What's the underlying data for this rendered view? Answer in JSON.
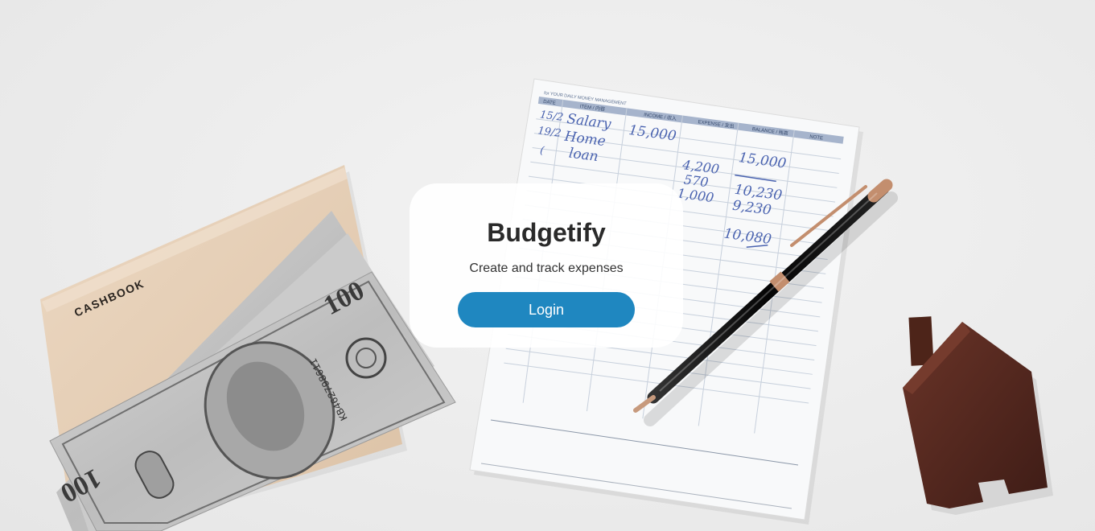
{
  "app": {
    "title": "Budgetify",
    "subtitle": "Create and track expenses",
    "login_label": "Login"
  },
  "background": {
    "cashbook_label": "CASHBOOK",
    "sheet_header": "for YOUR DAILY MONEY MANAGEMENT",
    "columns": [
      "DATE",
      "ITEM / 内容",
      "INCOME / 収入",
      "EXPENSE / 支出",
      "BALANCE / 残高",
      "NOTE"
    ],
    "handwriting": {
      "dates": [
        "15/2",
        "19/2",
        "("
      ],
      "items": [
        "Salary",
        "Home",
        "loan"
      ],
      "income": [
        "15,000"
      ],
      "expense": [
        "4,200",
        "570",
        "1,000"
      ],
      "balance": [
        "15,000",
        "10,230",
        "9,230",
        "10,080"
      ]
    },
    "banknote_value": "100",
    "banknote_serial": "KB46279861I",
    "colors": {
      "accent": "#1f87c0",
      "house": "#5a2c22",
      "cashbook": "#e6d0b8"
    }
  }
}
